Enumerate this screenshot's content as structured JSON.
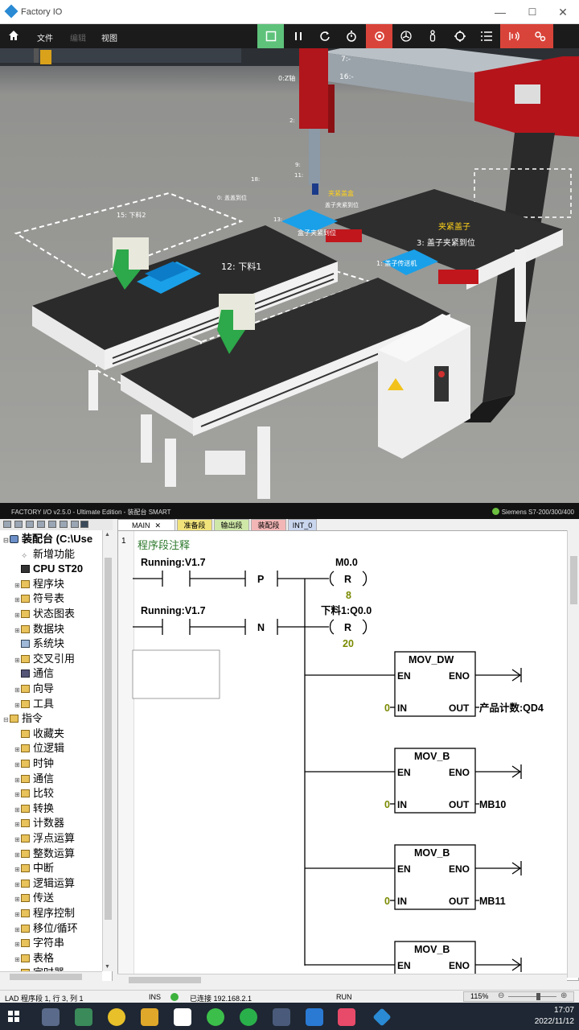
{
  "window": {
    "title": "Factory IO",
    "controls": [
      "—",
      "☐",
      "✕"
    ]
  },
  "menu": {
    "file": "文件",
    "edit": "编辑",
    "view": "视图"
  },
  "scene": {
    "labels": {
      "l7": "7:-",
      "l16": "16:-",
      "z_axis": "0:Z轴",
      "sensor_2": "2:",
      "sensor_9": "9:",
      "sensor_11": "11:",
      "sensor_18": "18:",
      "clamp_cover": "夹紧盖盒",
      "cover_clamp_ok": "盖子夹紧到位",
      "box_clamp_ok": "盒子夹紧到位",
      "l13_box": "13:",
      "right_clamp": "夹紧盖子",
      "l3_cover_clamp": "3: 盖子夹紧到位",
      "l12_unload": "12: 下料1",
      "l15": "15: 下料2",
      "l1_cover_conveyor": "1: 盖子传送机",
      "l0_cover_arrive": "0: 盖盖到位"
    }
  },
  "status3d": {
    "left": "FACTORY I/O v2.5.0 - Ultimate Edition - 装配台 SMART",
    "right": "Siemens S7-200/300/400"
  },
  "tree": {
    "items": [
      {
        "label": "装配台 (C:\\Use",
        "icon": "root",
        "exp": "⊟",
        "indent": 0,
        "bold": true
      },
      {
        "label": "新增功能",
        "icon": "star",
        "exp": "",
        "indent": 1,
        "bold": false
      },
      {
        "label": "CPU ST20",
        "icon": "cpu",
        "exp": "",
        "indent": 1,
        "bold": true
      },
      {
        "label": "程序块",
        "icon": "folder",
        "exp": "⊞",
        "indent": 1,
        "bold": false
      },
      {
        "label": "符号表",
        "icon": "folder",
        "exp": "⊞",
        "indent": 1,
        "bold": false
      },
      {
        "label": "状态图表",
        "icon": "folder",
        "exp": "⊞",
        "indent": 1,
        "bold": false
      },
      {
        "label": "数据块",
        "icon": "folder",
        "exp": "⊞",
        "indent": 1,
        "bold": false
      },
      {
        "label": "系统块",
        "icon": "doc",
        "exp": "",
        "indent": 1,
        "bold": false
      },
      {
        "label": "交叉引用",
        "icon": "folder",
        "exp": "⊞",
        "indent": 1,
        "bold": false
      },
      {
        "label": "通信",
        "icon": "comm",
        "exp": "",
        "indent": 1,
        "bold": false
      },
      {
        "label": "向导",
        "icon": "folder",
        "exp": "⊞",
        "indent": 1,
        "bold": false
      },
      {
        "label": "工具",
        "icon": "folder",
        "exp": "⊞",
        "indent": 1,
        "bold": false
      },
      {
        "label": "指令",
        "icon": "folder",
        "exp": "⊟",
        "indent": 0,
        "bold": false
      },
      {
        "label": "收藏夹",
        "icon": "folder",
        "exp": "",
        "indent": 1,
        "bold": false
      },
      {
        "label": "位逻辑",
        "icon": "folder",
        "exp": "⊞",
        "indent": 1,
        "bold": false
      },
      {
        "label": "时钟",
        "icon": "folder",
        "exp": "⊞",
        "indent": 1,
        "bold": false
      },
      {
        "label": "通信",
        "icon": "folder",
        "exp": "⊞",
        "indent": 1,
        "bold": false
      },
      {
        "label": "比较",
        "icon": "folder",
        "exp": "⊞",
        "indent": 1,
        "bold": false
      },
      {
        "label": "转换",
        "icon": "folder",
        "exp": "⊞",
        "indent": 1,
        "bold": false
      },
      {
        "label": "计数器",
        "icon": "folder",
        "exp": "⊞",
        "indent": 1,
        "bold": false
      },
      {
        "label": "浮点运算",
        "icon": "folder",
        "exp": "⊞",
        "indent": 1,
        "bold": false
      },
      {
        "label": "整数运算",
        "icon": "folder",
        "exp": "⊞",
        "indent": 1,
        "bold": false
      },
      {
        "label": "中断",
        "icon": "folder",
        "exp": "⊞",
        "indent": 1,
        "bold": false
      },
      {
        "label": "逻辑运算",
        "icon": "folder",
        "exp": "⊞",
        "indent": 1,
        "bold": false
      },
      {
        "label": "传送",
        "icon": "folder",
        "exp": "⊞",
        "indent": 1,
        "bold": false
      },
      {
        "label": "程序控制",
        "icon": "folder",
        "exp": "⊞",
        "indent": 1,
        "bold": false
      },
      {
        "label": "移位/循环",
        "icon": "folder",
        "exp": "⊞",
        "indent": 1,
        "bold": false
      },
      {
        "label": "字符串",
        "icon": "folder",
        "exp": "⊞",
        "indent": 1,
        "bold": false
      },
      {
        "label": "表格",
        "icon": "folder",
        "exp": "⊞",
        "indent": 1,
        "bold": false
      },
      {
        "label": "定时器",
        "icon": "folder",
        "exp": "⊞",
        "indent": 1,
        "bold": false
      }
    ]
  },
  "tabs": [
    {
      "label": "MAIN",
      "bg": "#ffffff",
      "close": "✕"
    },
    {
      "label": "准备段",
      "bg": "#f2e27a",
      "close": ""
    },
    {
      "label": "输出段",
      "bg": "#cfe8a8",
      "close": ""
    },
    {
      "label": "装配段",
      "bg": "#f3b6b6",
      "close": ""
    },
    {
      "label": "INT_0",
      "bg": "#c9d6ee",
      "close": ""
    }
  ],
  "editor": {
    "network_number": "1",
    "network_comment": "程序段注释",
    "rung1_contact": "Running:V1.7",
    "rung1_edge": "P",
    "rung1_coil_addr": "M0.0",
    "rung1_coil_type": "R",
    "rung1_coil_n": "8",
    "rung2_contact": "Running:V1.7",
    "rung2_edge": "N",
    "rung2_coil_addr": "下料1:Q0.0",
    "rung2_coil_type": "R",
    "rung2_coil_n": "20",
    "box1": {
      "name": "MOV_DW",
      "en": "EN",
      "eno": "ENO",
      "in_label": "IN",
      "out_label": "OUT",
      "in_val": "0",
      "out_val": "产品计数:QD4"
    },
    "box2": {
      "name": "MOV_B",
      "en": "EN",
      "eno": "ENO",
      "in_label": "IN",
      "out_label": "OUT",
      "in_val": "0",
      "out_val": "MB10"
    },
    "box3": {
      "name": "MOV_B",
      "en": "EN",
      "eno": "ENO",
      "in_label": "IN",
      "out_label": "OUT",
      "in_val": "0",
      "out_val": "MB11"
    },
    "box4": {
      "name": "MOV_B",
      "en": "EN",
      "eno": "ENO"
    }
  },
  "statusbar": {
    "position": "LAD 程序段 1, 行 3, 列 1",
    "mode": "INS",
    "connection": "已连接 192.168.2.1",
    "run": "RUN",
    "zoom": "115%"
  },
  "taskbar": {
    "time": "17:07",
    "date": "2022/11/12"
  },
  "colors": {
    "accent_green": "#5ec27b",
    "accent_red": "#d9443a",
    "toolbar_bg": "#1b1b1b"
  }
}
